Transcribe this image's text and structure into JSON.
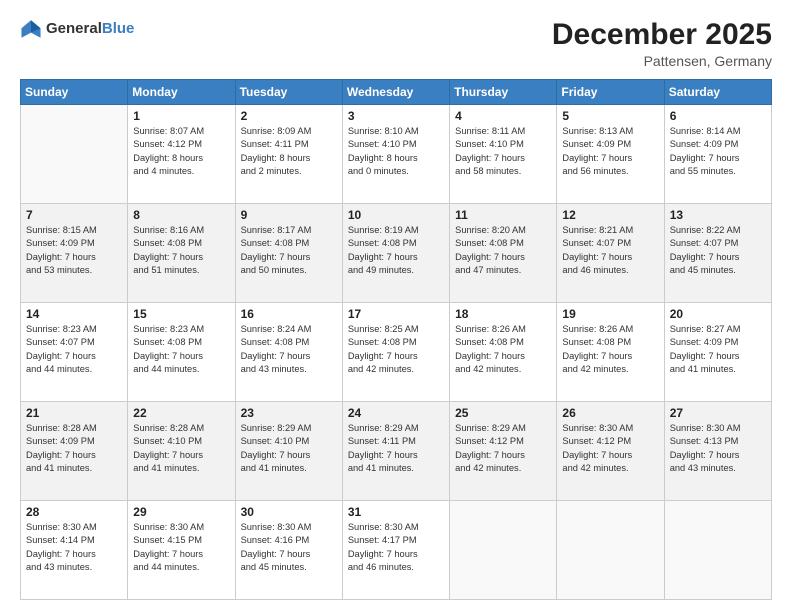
{
  "header": {
    "logo_general": "General",
    "logo_blue": "Blue",
    "month": "December 2025",
    "location": "Pattensen, Germany"
  },
  "weekdays": [
    "Sunday",
    "Monday",
    "Tuesday",
    "Wednesday",
    "Thursday",
    "Friday",
    "Saturday"
  ],
  "weeks": [
    [
      {
        "day": "",
        "info": ""
      },
      {
        "day": "1",
        "info": "Sunrise: 8:07 AM\nSunset: 4:12 PM\nDaylight: 8 hours\nand 4 minutes."
      },
      {
        "day": "2",
        "info": "Sunrise: 8:09 AM\nSunset: 4:11 PM\nDaylight: 8 hours\nand 2 minutes."
      },
      {
        "day": "3",
        "info": "Sunrise: 8:10 AM\nSunset: 4:10 PM\nDaylight: 8 hours\nand 0 minutes."
      },
      {
        "day": "4",
        "info": "Sunrise: 8:11 AM\nSunset: 4:10 PM\nDaylight: 7 hours\nand 58 minutes."
      },
      {
        "day": "5",
        "info": "Sunrise: 8:13 AM\nSunset: 4:09 PM\nDaylight: 7 hours\nand 56 minutes."
      },
      {
        "day": "6",
        "info": "Sunrise: 8:14 AM\nSunset: 4:09 PM\nDaylight: 7 hours\nand 55 minutes."
      }
    ],
    [
      {
        "day": "7",
        "info": "Sunrise: 8:15 AM\nSunset: 4:09 PM\nDaylight: 7 hours\nand 53 minutes."
      },
      {
        "day": "8",
        "info": "Sunrise: 8:16 AM\nSunset: 4:08 PM\nDaylight: 7 hours\nand 51 minutes."
      },
      {
        "day": "9",
        "info": "Sunrise: 8:17 AM\nSunset: 4:08 PM\nDaylight: 7 hours\nand 50 minutes."
      },
      {
        "day": "10",
        "info": "Sunrise: 8:19 AM\nSunset: 4:08 PM\nDaylight: 7 hours\nand 49 minutes."
      },
      {
        "day": "11",
        "info": "Sunrise: 8:20 AM\nSunset: 4:08 PM\nDaylight: 7 hours\nand 47 minutes."
      },
      {
        "day": "12",
        "info": "Sunrise: 8:21 AM\nSunset: 4:07 PM\nDaylight: 7 hours\nand 46 minutes."
      },
      {
        "day": "13",
        "info": "Sunrise: 8:22 AM\nSunset: 4:07 PM\nDaylight: 7 hours\nand 45 minutes."
      }
    ],
    [
      {
        "day": "14",
        "info": "Sunrise: 8:23 AM\nSunset: 4:07 PM\nDaylight: 7 hours\nand 44 minutes."
      },
      {
        "day": "15",
        "info": "Sunrise: 8:23 AM\nSunset: 4:08 PM\nDaylight: 7 hours\nand 44 minutes."
      },
      {
        "day": "16",
        "info": "Sunrise: 8:24 AM\nSunset: 4:08 PM\nDaylight: 7 hours\nand 43 minutes."
      },
      {
        "day": "17",
        "info": "Sunrise: 8:25 AM\nSunset: 4:08 PM\nDaylight: 7 hours\nand 42 minutes."
      },
      {
        "day": "18",
        "info": "Sunrise: 8:26 AM\nSunset: 4:08 PM\nDaylight: 7 hours\nand 42 minutes."
      },
      {
        "day": "19",
        "info": "Sunrise: 8:26 AM\nSunset: 4:08 PM\nDaylight: 7 hours\nand 42 minutes."
      },
      {
        "day": "20",
        "info": "Sunrise: 8:27 AM\nSunset: 4:09 PM\nDaylight: 7 hours\nand 41 minutes."
      }
    ],
    [
      {
        "day": "21",
        "info": "Sunrise: 8:28 AM\nSunset: 4:09 PM\nDaylight: 7 hours\nand 41 minutes."
      },
      {
        "day": "22",
        "info": "Sunrise: 8:28 AM\nSunset: 4:10 PM\nDaylight: 7 hours\nand 41 minutes."
      },
      {
        "day": "23",
        "info": "Sunrise: 8:29 AM\nSunset: 4:10 PM\nDaylight: 7 hours\nand 41 minutes."
      },
      {
        "day": "24",
        "info": "Sunrise: 8:29 AM\nSunset: 4:11 PM\nDaylight: 7 hours\nand 41 minutes."
      },
      {
        "day": "25",
        "info": "Sunrise: 8:29 AM\nSunset: 4:12 PM\nDaylight: 7 hours\nand 42 minutes."
      },
      {
        "day": "26",
        "info": "Sunrise: 8:30 AM\nSunset: 4:12 PM\nDaylight: 7 hours\nand 42 minutes."
      },
      {
        "day": "27",
        "info": "Sunrise: 8:30 AM\nSunset: 4:13 PM\nDaylight: 7 hours\nand 43 minutes."
      }
    ],
    [
      {
        "day": "28",
        "info": "Sunrise: 8:30 AM\nSunset: 4:14 PM\nDaylight: 7 hours\nand 43 minutes."
      },
      {
        "day": "29",
        "info": "Sunrise: 8:30 AM\nSunset: 4:15 PM\nDaylight: 7 hours\nand 44 minutes."
      },
      {
        "day": "30",
        "info": "Sunrise: 8:30 AM\nSunset: 4:16 PM\nDaylight: 7 hours\nand 45 minutes."
      },
      {
        "day": "31",
        "info": "Sunrise: 8:30 AM\nSunset: 4:17 PM\nDaylight: 7 hours\nand 46 minutes."
      },
      {
        "day": "",
        "info": ""
      },
      {
        "day": "",
        "info": ""
      },
      {
        "day": "",
        "info": ""
      }
    ]
  ]
}
